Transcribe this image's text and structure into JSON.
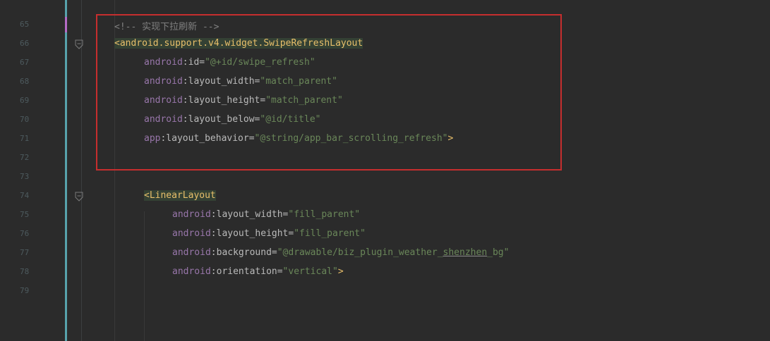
{
  "editor": {
    "lines": [
      {
        "no": "65",
        "parts": [
          {
            "t": "<!-- 实现下拉刷新 -->",
            "c": "t-comment"
          }
        ],
        "indent": 162
      },
      {
        "no": "66",
        "fold": true,
        "parts": [
          {
            "t": "<",
            "c": "t-bracket"
          },
          {
            "t": "android.support.v4.widget.SwipeRefreshLayout",
            "c": "t-tag"
          }
        ],
        "indent": 162,
        "tagHl": true
      },
      {
        "no": "67",
        "parts": [
          {
            "t": "android",
            "c": "t-ns"
          },
          {
            "t": ":id=",
            "c": "t-attr"
          },
          {
            "t": "\"@+id/swipe_refresh\"",
            "c": "t-val"
          }
        ],
        "indent": 204
      },
      {
        "no": "68",
        "parts": [
          {
            "t": "android",
            "c": "t-ns"
          },
          {
            "t": ":layout_width=",
            "c": "t-attr"
          },
          {
            "t": "\"match_parent\"",
            "c": "t-val"
          }
        ],
        "indent": 204
      },
      {
        "no": "69",
        "parts": [
          {
            "t": "android",
            "c": "t-ns"
          },
          {
            "t": ":layout_height=",
            "c": "t-attr"
          },
          {
            "t": "\"match_parent\"",
            "c": "t-val"
          }
        ],
        "indent": 204
      },
      {
        "no": "70",
        "parts": [
          {
            "t": "android",
            "c": "t-ns"
          },
          {
            "t": ":layout_below=",
            "c": "t-attr"
          },
          {
            "t": "\"@id/title\"",
            "c": "t-val"
          }
        ],
        "indent": 204
      },
      {
        "no": "71",
        "parts": [
          {
            "t": "app",
            "c": "t-ns"
          },
          {
            "t": ":layout_behavior=",
            "c": "t-attr"
          },
          {
            "t": "\"@string/app_bar_scrolling_refresh\"",
            "c": "t-val"
          },
          {
            "t": ">",
            "c": "t-bracket"
          }
        ],
        "indent": 204
      },
      {
        "no": "72",
        "parts": [],
        "indent": 204
      },
      {
        "no": "73",
        "parts": [],
        "indent": 204
      },
      {
        "no": "74",
        "fold": true,
        "parts": [
          {
            "t": "<",
            "c": "t-bracket"
          },
          {
            "t": "LinearLayout",
            "c": "t-tag"
          }
        ],
        "indent": 204,
        "tagHl": true
      },
      {
        "no": "75",
        "parts": [
          {
            "t": "android",
            "c": "t-ns"
          },
          {
            "t": ":layout_width=",
            "c": "t-attr"
          },
          {
            "t": "\"fill_parent\"",
            "c": "t-val"
          }
        ],
        "indent": 244
      },
      {
        "no": "76",
        "parts": [
          {
            "t": "android",
            "c": "t-ns"
          },
          {
            "t": ":layout_height=",
            "c": "t-attr"
          },
          {
            "t": "\"fill_parent\"",
            "c": "t-val"
          }
        ],
        "indent": 244
      },
      {
        "no": "77",
        "parts": [
          {
            "t": "android",
            "c": "t-ns"
          },
          {
            "t": ":background=",
            "c": "t-attr"
          },
          {
            "t": "\"@drawable/biz_plugin_weather_",
            "c": "t-val"
          },
          {
            "t": "shenzhen",
            "c": "t-val t-underline"
          },
          {
            "t": "_bg\"",
            "c": "t-val"
          }
        ],
        "indent": 244
      },
      {
        "no": "78",
        "parts": [
          {
            "t": "android",
            "c": "t-ns"
          },
          {
            "t": ":orientation=",
            "c": "t-attr"
          },
          {
            "t": "\"vertical\"",
            "c": "t-val"
          },
          {
            "t": ">",
            "c": "t-bracket"
          }
        ],
        "indent": 244
      },
      {
        "no": "79",
        "parts": [],
        "indent": 244
      }
    ]
  }
}
